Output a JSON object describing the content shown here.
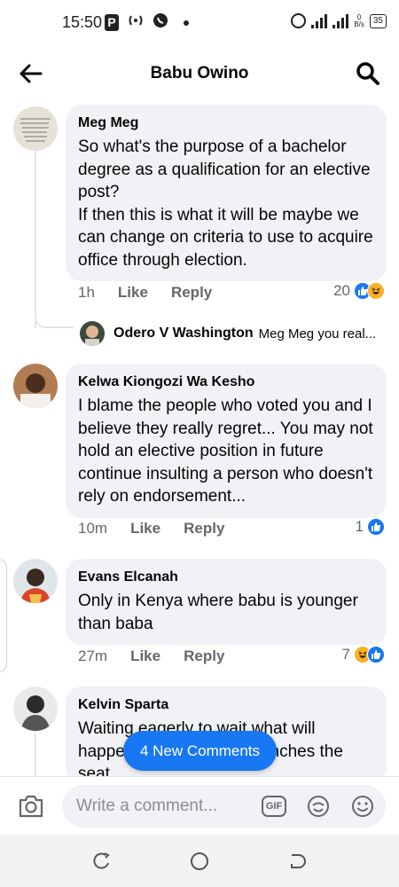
{
  "status_bar": {
    "time": "15:50",
    "p_icon": "P",
    "speed_value": "0",
    "speed_unit": "B/s",
    "battery": "35"
  },
  "header": {
    "title": "Babu Owino",
    "back_icon": "arrow-left-icon",
    "search_icon": "search-icon"
  },
  "comments": [
    {
      "author": "Meg Meg",
      "text": "So what's the purpose of a bachelor degree as a qualification for an elective post?\nIf then this is what it will be maybe we can change on criteria to use to acquire office through election.",
      "time": "1h",
      "like_label": "Like",
      "reply_label": "Reply",
      "reaction_count": "20",
      "reactions": [
        "like",
        "haha"
      ],
      "reply_preview": {
        "author": "Odero V Washington",
        "snippet": "Meg Meg you real..."
      }
    },
    {
      "author": "Kelwa Kiongozi Wa Kesho",
      "text": "I blame the people who voted you and I believe they really regret... You may not hold an elective position in future continue insulting a person who doesn't rely on endorsement...",
      "time": "10m",
      "like_label": "Like",
      "reply_label": "Reply",
      "reaction_count": "1",
      "reactions": [
        "like"
      ]
    },
    {
      "author": "Evans Elcanah",
      "text": "Only in Kenya where babu is younger than baba",
      "time": "27m",
      "like_label": "Like",
      "reply_label": "Reply",
      "reaction_count": "7",
      "reactions": [
        "haha",
        "like"
      ]
    },
    {
      "author": "Kelvin Sparta",
      "text": "Waiting eagerly to wait what will happen if Raila Odinga clinches the seat"
    }
  ],
  "new_comments_pill": "4 New Comments",
  "composer": {
    "placeholder": "Write a comment...",
    "gif_label": "GIF"
  },
  "colors": {
    "accent": "#1877f2",
    "bubble": "#f0f2f5",
    "meta_text": "#65676b"
  }
}
